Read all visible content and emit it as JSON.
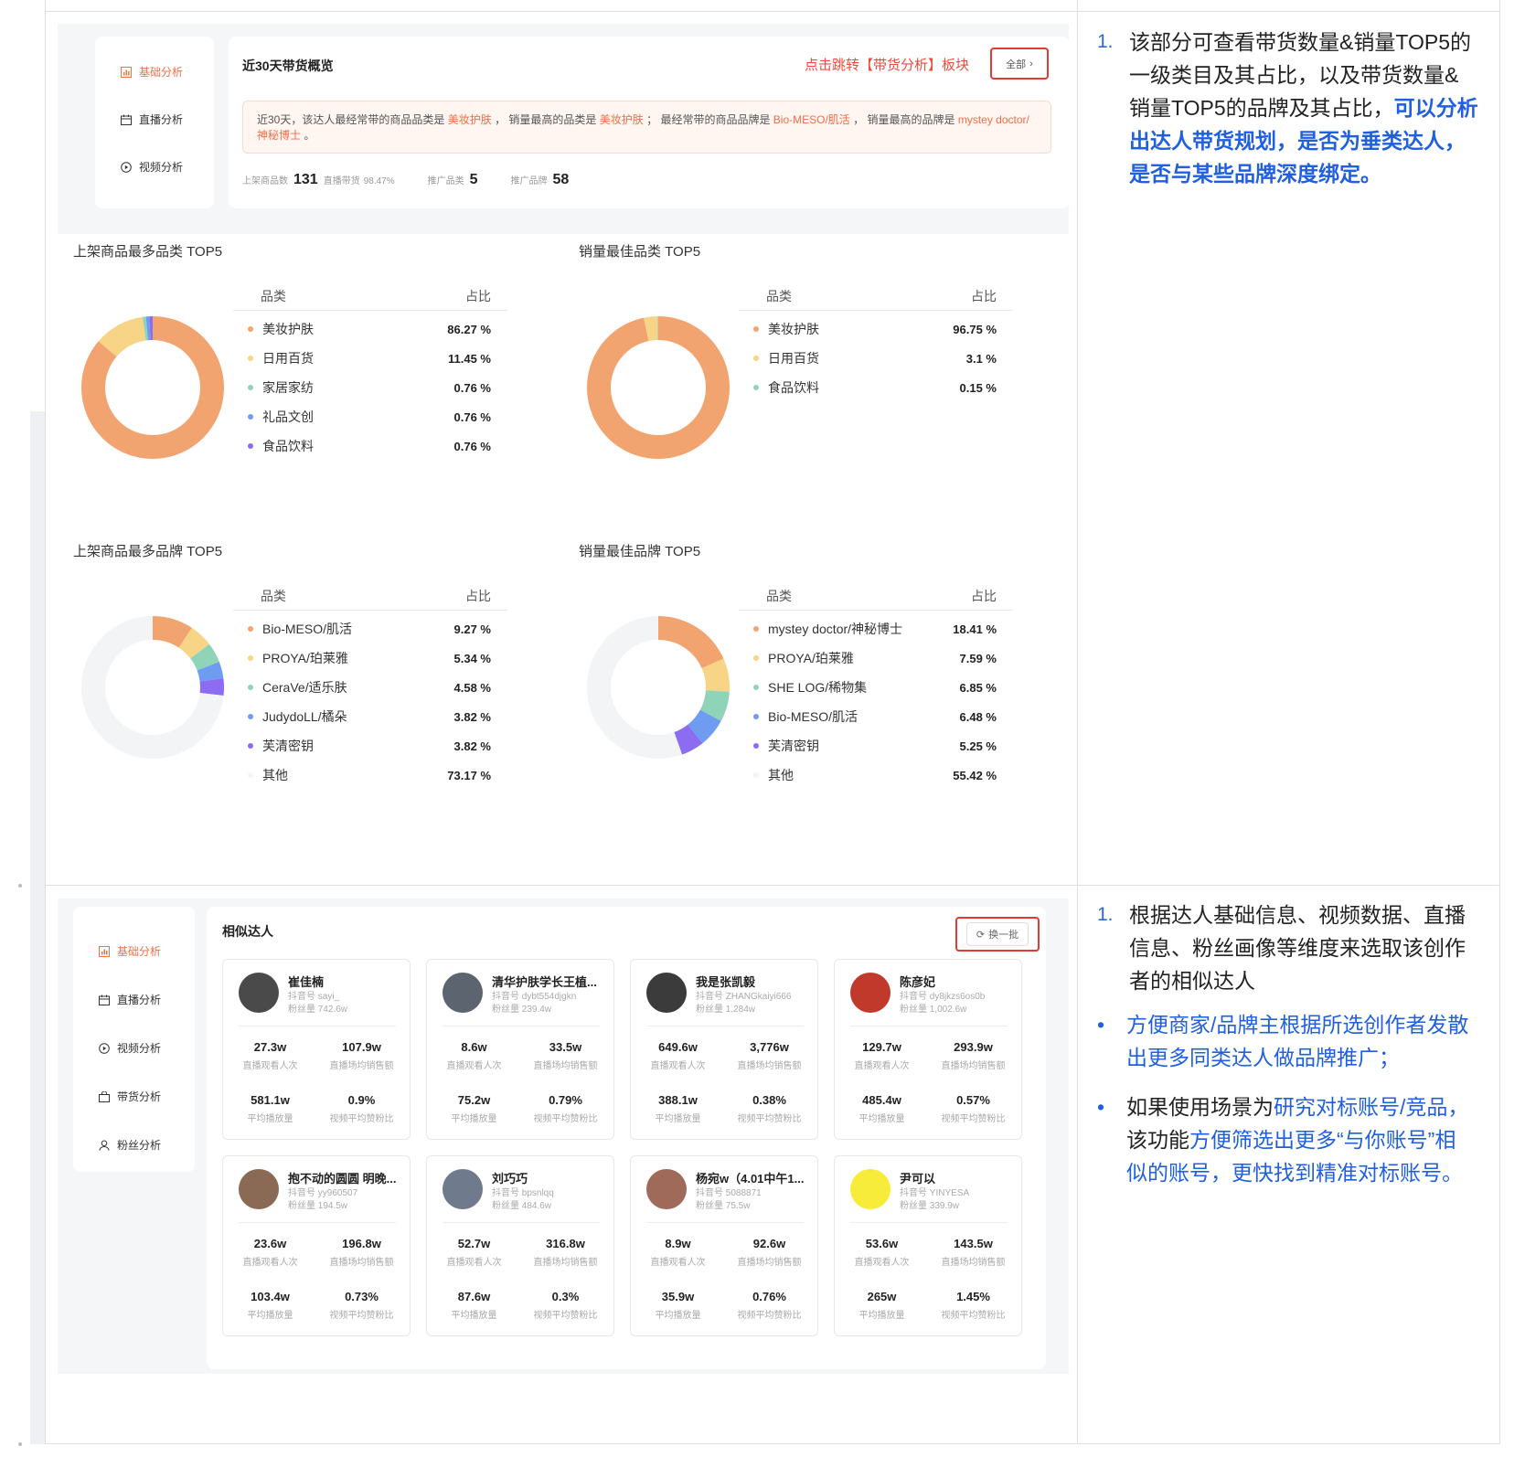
{
  "section1": {
    "nav": [
      {
        "label": "基础分析",
        "active": true,
        "icon": "bar-chart-icon"
      },
      {
        "label": "直播分析",
        "active": false,
        "icon": "calendar-icon"
      },
      {
        "label": "视频分析",
        "active": false,
        "icon": "play-circle-icon"
      }
    ],
    "card_title": "近30天带货概览",
    "jump_link": "点击跳转【带货分析】板块",
    "all_button": "全部",
    "summary": {
      "p1": "近30天，该达人最经常带的商品品类是",
      "v1": "美妆护肤",
      "p2": "，  销量最高的品类是",
      "v2": "美妆护肤",
      "p3": "；  最经常带的商品品牌是",
      "v3": "Bio-MESO/肌活",
      "p4": "，  销量最高的品牌是",
      "v4": "mystey doctor/神秘博士",
      "p5": "。"
    },
    "stats": {
      "listed_label": "上架商品数",
      "listed_value": "131",
      "live_label": "直播带货",
      "live_value": "98.47%",
      "cat_label": "推广品类",
      "cat_value": "5",
      "brand_label": "推广品牌",
      "brand_value": "58"
    }
  },
  "charts": {
    "header_name": "品类",
    "header_ratio": "占比",
    "colors": [
      "#f2a470",
      "#f7d486",
      "#8fd4b8",
      "#6e9cf0",
      "#8c6cf0",
      "#f3f4f6"
    ]
  },
  "chart_data": [
    {
      "type": "pie",
      "title": "上架商品最多品类 TOP5",
      "categories": [
        "美妆护肤",
        "日用百货",
        "家居家纺",
        "礼品文创",
        "食品饮料"
      ],
      "values": [
        86.27,
        11.45,
        0.76,
        0.76,
        0.76
      ],
      "display": [
        "86.27 %",
        "11.45 %",
        "0.76 %",
        "0.76 %",
        "0.76 %"
      ]
    },
    {
      "type": "pie",
      "title": "销量最佳品类 TOP5",
      "categories": [
        "美妆护肤",
        "日用百货",
        "食品饮料"
      ],
      "values": [
        96.75,
        3.1,
        0.15
      ],
      "display": [
        "96.75 %",
        "3.1 %",
        "0.15 %"
      ]
    },
    {
      "type": "pie",
      "title": "上架商品最多品牌 TOP5",
      "categories": [
        "Bio-MESO/肌活",
        "PROYA/珀莱雅",
        "CeraVe/适乐肤",
        "JudydoLL/橘朵",
        "芙清密钥",
        "其他"
      ],
      "values": [
        9.27,
        5.34,
        4.58,
        3.82,
        3.82,
        73.17
      ],
      "display": [
        "9.27 %",
        "5.34 %",
        "4.58 %",
        "3.82 %",
        "3.82 %",
        "73.17 %"
      ]
    },
    {
      "type": "pie",
      "title": "销量最佳品牌 TOP5",
      "categories": [
        "mystey doctor/神秘博士",
        "PROYA/珀莱雅",
        "SHE LOG/稀物集",
        "Bio-MESO/肌活",
        "芙清密钥",
        "其他"
      ],
      "values": [
        18.41,
        7.59,
        6.85,
        6.48,
        5.25,
        55.42
      ],
      "display": [
        "18.41 %",
        "7.59 %",
        "6.85 %",
        "6.48 %",
        "5.25 %",
        "55.42 %"
      ]
    }
  ],
  "note1": {
    "num": "1.",
    "line1": "该部分可查看带货数量&销量TOP5的",
    "line2": "一级类目及其占比，以及带货数量&",
    "line3a": "销量TOP5的品牌及其占比，",
    "line3b": "可以分析",
    "line4": "出达人带货规划，是否为垂类达人，",
    "line5": "是否与某些品牌深度绑定。"
  },
  "section2": {
    "nav": [
      {
        "label": "基础分析",
        "active": true,
        "icon": "bar-chart-icon"
      },
      {
        "label": "直播分析",
        "active": false,
        "icon": "calendar-icon"
      },
      {
        "label": "视频分析",
        "active": false,
        "icon": "play-circle-icon"
      },
      {
        "label": "带货分析",
        "active": false,
        "icon": "shopping-bag-icon"
      },
      {
        "label": "粉丝分析",
        "active": false,
        "icon": "user-icon"
      }
    ],
    "title": "相似达人",
    "refresh_button": "换一批",
    "metric_labels": [
      "直播观看人次",
      "直播场均销售额",
      "平均播放量",
      "视频平均赞粉比"
    ],
    "kols": [
      {
        "name": "崔佳楠",
        "id": "抖音号 sayi_",
        "fans": "粉丝量 742.6w",
        "m": [
          "27.3w",
          "107.9w",
          "581.1w",
          "0.9%"
        ],
        "avatar": "#4a4a4a"
      },
      {
        "name": "清华护肤学长王植...",
        "id": "抖音号 dybt554djgkn",
        "fans": "粉丝量 239.4w",
        "m": [
          "8.6w",
          "33.5w",
          "75.2w",
          "0.79%"
        ],
        "avatar": "#5c6470"
      },
      {
        "name": "我是张凯毅",
        "id": "抖音号 ZHANGkaiyi666",
        "fans": "粉丝量 1,284w",
        "m": [
          "649.6w",
          "3,776w",
          "388.1w",
          "0.38%"
        ],
        "avatar": "#3b3b3b"
      },
      {
        "name": "陈彦妃",
        "id": "抖音号 dy8jkzs6os0b",
        "fans": "粉丝量 1,002.6w",
        "m": [
          "129.7w",
          "293.9w",
          "485.4w",
          "0.57%"
        ],
        "avatar": "#c0392b"
      },
      {
        "name": "抱不动的圆圆 明晚...",
        "id": "抖音号 yy960507",
        "fans": "粉丝量 194.5w",
        "m": [
          "23.6w",
          "196.8w",
          "103.4w",
          "0.73%"
        ],
        "avatar": "#8a6a55"
      },
      {
        "name": "刘巧巧",
        "id": "抖音号 bpsnlqq",
        "fans": "粉丝量 484.6w",
        "m": [
          "52.7w",
          "316.8w",
          "87.6w",
          "0.3%"
        ],
        "avatar": "#6f7b8c"
      },
      {
        "name": "杨宛w（4.01中午1...",
        "id": "抖音号 5088871",
        "fans": "粉丝量 75.5w",
        "m": [
          "8.9w",
          "92.6w",
          "35.9w",
          "0.76%"
        ],
        "avatar": "#a06a5a"
      },
      {
        "name": "尹可以",
        "id": "抖音号 YINYESA",
        "fans": "粉丝量 339.9w",
        "m": [
          "53.6w",
          "143.5w",
          "265w",
          "1.45%"
        ],
        "avatar": "#f7ec3a"
      }
    ]
  },
  "note2": {
    "num": "1.",
    "line1": "根据达人基础信息、视频数据、直播",
    "line2": "信息、粉丝画像等维度来选取该创作",
    "line3": "者的相似达人",
    "b1_line1": "方便商家/品牌主根据所选创作者发散",
    "b1_line2": "出更多同类达人做品牌推广；",
    "b2_line1a": "如果使用场景为",
    "b2_line1b": "研究对标账号/竞品，",
    "b2_line2a": "该功能",
    "b2_line2b": "方便筛选出更多“与你账号”相",
    "b2_line3": "似的账号，更快找到精准对标账号。",
    "bullet": "•"
  }
}
